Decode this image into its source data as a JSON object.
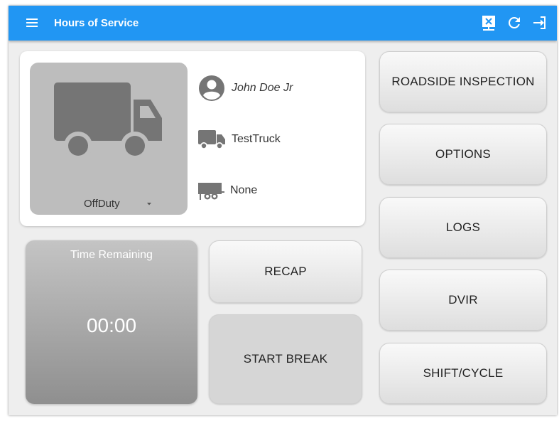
{
  "appbar": {
    "title": "Hours of Service",
    "menu_icon": "hamburger-menu-icon",
    "actions": [
      "transfer-icon",
      "refresh-icon",
      "logout-icon"
    ],
    "color": "#2196f3"
  },
  "status": {
    "current": "OffDuty",
    "icon": "truck-icon"
  },
  "info": {
    "driver": "John Doe Jr",
    "vehicle": "TestTruck",
    "trailer": "None"
  },
  "timer": {
    "label": "Time Remaining",
    "value": "00:00"
  },
  "buttons": {
    "recap": "RECAP",
    "start_break": "START BREAK",
    "roadside_inspection": "ROADSIDE INSPECTION",
    "options": "OPTIONS",
    "logs": "LOGS",
    "dvir": "DVIR",
    "shift_cycle": "SHIFT/CYCLE"
  }
}
